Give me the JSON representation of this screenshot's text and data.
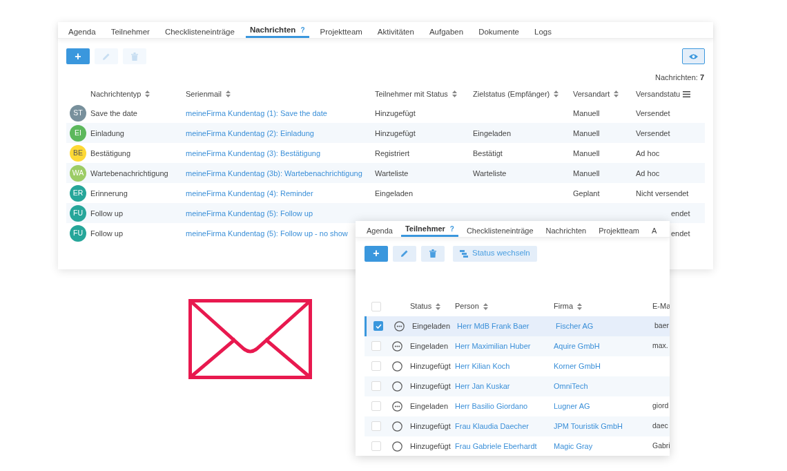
{
  "messages_panel": {
    "tabs": [
      {
        "label": "Agenda",
        "selected": false
      },
      {
        "label": "Teilnehmer",
        "selected": false
      },
      {
        "label": "Checklisteneinträge",
        "selected": false
      },
      {
        "label": "Nachrichten",
        "selected": true,
        "help": "?"
      },
      {
        "label": "Projektteam",
        "selected": false
      },
      {
        "label": "Aktivitäten",
        "selected": false
      },
      {
        "label": "Aufgaben",
        "selected": false
      },
      {
        "label": "Dokumente",
        "selected": false
      },
      {
        "label": "Logs",
        "selected": false
      }
    ],
    "toolbar": [
      {
        "kind": "add",
        "label": "+",
        "disabled": false
      },
      {
        "kind": "edit",
        "disabled": true
      },
      {
        "kind": "delete",
        "disabled": true
      }
    ],
    "count_label": "Nachrichten:",
    "count": "7",
    "columns": [
      "Nachrichtentyp",
      "Serienmail",
      "Teilnehmer mit Status",
      "Zielstatus (Empfänger)",
      "Versandart",
      "Versandstatu"
    ],
    "rows": [
      {
        "initials": "ST",
        "color": "#78909c",
        "type": "Save the date",
        "mail": "meineFirma Kundentag (1): Save the date",
        "participant_status": "Hinzugefügt",
        "target_status": "",
        "method": "Manuell",
        "send_status": "Versendet"
      },
      {
        "initials": "EI",
        "color": "#5cb85c",
        "type": "Einladung",
        "mail": "meineFirma Kundentag (2): Einladung",
        "participant_status": "Hinzugefügt",
        "target_status": "Eingeladen",
        "method": "Manuell",
        "send_status": "Versendet"
      },
      {
        "initials": "BE",
        "color": "#fdd835",
        "type": "Bestätigung",
        "mail": "meineFirma Kundentag (3): Bestätigung",
        "participant_status": "Registriert",
        "target_status": "Bestätigt",
        "method": "Manuell",
        "send_status": "Ad hoc"
      },
      {
        "initials": "WA",
        "color": "#9ccc65",
        "type": "Wartebenachrichtigung",
        "mail": "meineFirma Kundentag (3b): Wartebenachrichtigung",
        "participant_status": "Warteliste",
        "target_status": "Warteliste",
        "method": "Manuell",
        "send_status": "Ad hoc"
      },
      {
        "initials": "ER",
        "color": "#26a69a",
        "type": "Erinnerung",
        "mail": "meineFirma Kundentag (4): Reminder",
        "participant_status": "Eingeladen",
        "target_status": "",
        "method": "Geplant",
        "send_status": "Nicht versendet"
      },
      {
        "initials": "FU",
        "color": "#26a69a",
        "type": "Follow up",
        "mail": "meineFirma Kundentag (5): Follow up",
        "send_status": "endet",
        "covered": true
      },
      {
        "initials": "FU",
        "color": "#26a69a",
        "type": "Follow up",
        "mail": "meineFirma Kundentag (5): Follow up - no show",
        "send_status": "endet",
        "covered": true
      }
    ]
  },
  "participants_panel": {
    "tabs": [
      {
        "label": "Agenda",
        "selected": false
      },
      {
        "label": "Teilnehmer",
        "selected": true,
        "help": "?"
      },
      {
        "label": "Checklisteneinträge",
        "selected": false
      },
      {
        "label": "Nachrichten",
        "selected": false
      },
      {
        "label": "Projektteam",
        "selected": false
      },
      {
        "label": "A",
        "selected": false
      }
    ],
    "toolbar": [
      {
        "kind": "add",
        "label": "+",
        "disabled": false
      },
      {
        "kind": "edit",
        "disabled": false
      },
      {
        "kind": "delete",
        "disabled": false
      },
      {
        "kind": "status",
        "label": "Status wechseln",
        "disabled": false
      }
    ],
    "select_all": {
      "checked": false
    },
    "columns": [
      "Status",
      "Person",
      "Firma",
      "E-Ma"
    ],
    "rows": [
      {
        "selected": true,
        "kind": "invited",
        "status": "Eingeladen",
        "person": "Herr MdB Frank Baer",
        "company": "Fischer AG",
        "email": "baer"
      },
      {
        "selected": false,
        "kind": "invited",
        "status": "Eingeladen",
        "person": "Herr Maximilian Huber",
        "company": "Aquire GmbH",
        "email": "max."
      },
      {
        "selected": false,
        "kind": "added",
        "status": "Hinzugefügt",
        "person": "Herr Kilian Koch",
        "company": "Korner GmbH"
      },
      {
        "selected": false,
        "kind": "added",
        "status": "Hinzugefügt",
        "person": "Herr Jan Kuskar",
        "company": "OmniTech"
      },
      {
        "selected": false,
        "kind": "invited",
        "status": "Eingeladen",
        "person": "Herr Basilio Giordano",
        "company": "Lugner AG",
        "email": "giord"
      },
      {
        "selected": false,
        "kind": "added",
        "status": "Hinzugefügt",
        "person": "Frau Klaudia Daecher",
        "company": "JPM Touristik GmbH",
        "email": "daec"
      },
      {
        "selected": false,
        "kind": "added",
        "status": "Hinzugefügt",
        "person": "Frau Gabriele Eberhardt",
        "company": "Magic Gray",
        "email": "Gabri"
      }
    ]
  }
}
